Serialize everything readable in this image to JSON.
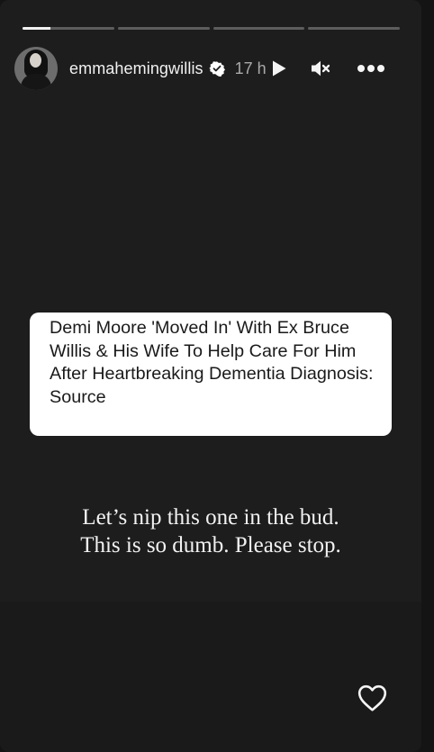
{
  "story": {
    "progress_total": 4,
    "progress_active_fraction": 0.3,
    "user": {
      "username": "emmahemingwillis",
      "verified_icon": "verified-badge-icon",
      "time": "17 h"
    },
    "controls": {
      "play_icon": "play-icon",
      "mute_icon": "muted-speaker-icon",
      "more_icon": "more-options-icon"
    },
    "article_card": {
      "title": "Demi Moore 'Moved In' With Ex Bruce Willis & His Wife To Help Care For Him After Heartbreaking Dementia Diagnosis: Source"
    },
    "caption": {
      "line1": "Let’s nip this one in the bud.",
      "line2": "This is so dumb. Please stop."
    },
    "reaction": {
      "like_icon": "heart-icon"
    },
    "colors": {
      "background": "#141414",
      "story_background": "#1d1d1d",
      "text": "#f2f2f2",
      "card": "#ffffff"
    }
  }
}
